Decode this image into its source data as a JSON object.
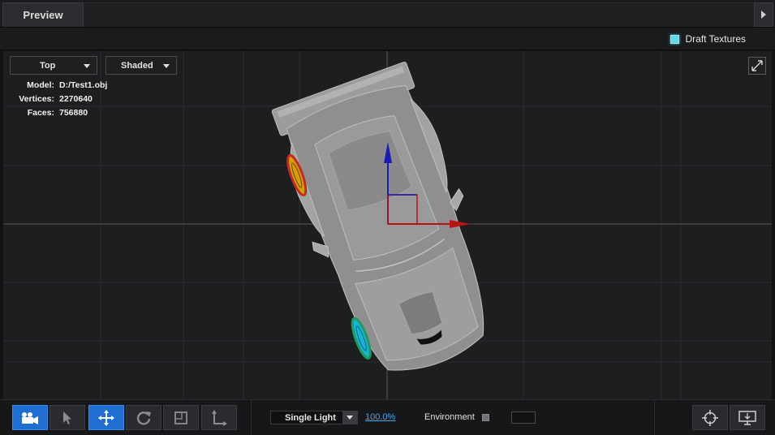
{
  "tabs": [
    {
      "label": "Preview"
    }
  ],
  "options": {
    "draft_textures_label": "Draft Textures",
    "draft_textures_checked": true
  },
  "viewport": {
    "view_mode": "Top",
    "shading_mode": "Shaded",
    "info": [
      {
        "key": "Model:",
        "value": "D:/Test1.obj"
      },
      {
        "key": "Vertices:",
        "value": "2270640"
      },
      {
        "key": "Faces:",
        "value": "756880"
      }
    ]
  },
  "toolbar": {
    "tools": [
      {
        "name": "camera-icon",
        "active": true
      },
      {
        "name": "select-arrow-icon",
        "active": false
      },
      {
        "name": "move-icon",
        "active": true
      },
      {
        "name": "rotate-icon",
        "active": false
      },
      {
        "name": "scale-icon",
        "active": false
      },
      {
        "name": "axis-icon",
        "active": false
      }
    ],
    "light_mode": "Single Light",
    "zoom": "100.0%",
    "environment_label": "Environment",
    "environment_checked": false
  },
  "colors": {
    "accent": "#1e6fd1",
    "axis_x": "#b81414",
    "axis_y": "#1a1ab8",
    "draft_check": "#5fd7e8"
  }
}
